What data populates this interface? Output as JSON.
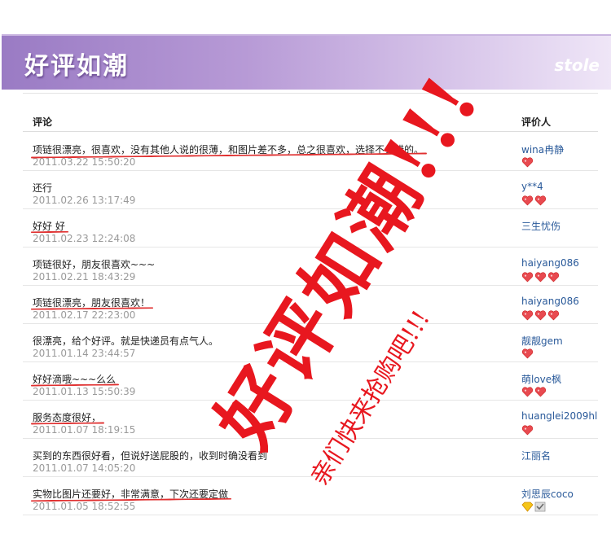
{
  "banner": {
    "title": "好评如潮",
    "brand": "stole"
  },
  "table": {
    "header_comment": "评论",
    "header_reviewer": "评价人",
    "rows": [
      {
        "comment": "项链很漂亮，很喜欢，没有其他人说的很薄，和图片差不多，总之很喜欢，选择不会错的。",
        "date": "2011.03.22 15:50:20",
        "reviewer": "wina冉静",
        "hearts": 1,
        "underline": true
      },
      {
        "comment": "还行",
        "date": "2011.02.26 13:17:49",
        "reviewer": "y**4",
        "hearts": 2,
        "underline": false
      },
      {
        "comment": "好好 好",
        "date": "2011.02.23 12:24:08",
        "reviewer": "三生忧伤",
        "hearts": 0,
        "underline": true
      },
      {
        "comment": "项链很好，朋友很喜欢~~~",
        "date": "2011.02.21 18:43:29",
        "reviewer": "haiyang086",
        "hearts": 3,
        "underline": false
      },
      {
        "comment": "项链很漂亮，朋友很喜欢！",
        "date": "2011.02.17 22:23:00",
        "reviewer": "haiyang086",
        "hearts": 3,
        "underline": true
      },
      {
        "comment": "很漂亮，给个好评。就是快递员有点气人。",
        "date": "2011.01.14 23:44:57",
        "reviewer": "靓靓gem",
        "hearts": 1,
        "underline": false
      },
      {
        "comment": "好好滴哦~~~么么",
        "date": "2011.01.13 15:50:39",
        "reviewer": "萌love枫",
        "hearts": 2,
        "underline": true
      },
      {
        "comment": "服务态度很好，",
        "date": "2011.01.07 18:19:15",
        "reviewer": "huanglei2009hl",
        "hearts": 1,
        "underline": true
      },
      {
        "comment": "买到的东西很好看，但说好送屁股的，收到时确没看到",
        "date": "2011.01.07 14:05:20",
        "reviewer": "江丽名",
        "hearts": 0,
        "underline": false
      },
      {
        "comment": "实物比图片还要好，非常满意，下次还要定做",
        "date": "2011.01.05 18:52:55",
        "reviewer": "刘思辰coco",
        "hearts": 0,
        "underline": true,
        "badge": true
      }
    ]
  },
  "overlay": {
    "big_slogan": "好评如潮!!!",
    "small_slogan": "亲们快来抢购吧!!!"
  },
  "colors": {
    "accent": "#e8171f",
    "banner": "#9a7bc4",
    "link": "#2a5a9a",
    "date": "#9a9a9a"
  }
}
